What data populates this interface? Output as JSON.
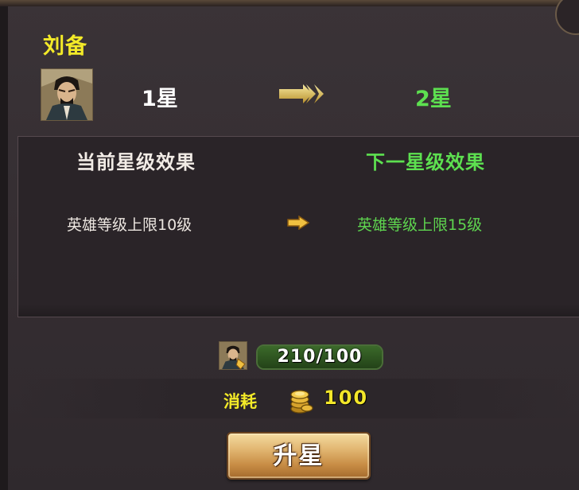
{
  "hero": {
    "name": "刘备",
    "current_star": "1星",
    "next_star": "2星"
  },
  "effects": {
    "current_title": "当前星级效果",
    "next_title": "下一星级效果",
    "current_value": "英雄等级上限10级",
    "next_value": "英雄等级上限15级"
  },
  "fragments": {
    "text": "210/100",
    "current": 210,
    "required": 100
  },
  "cost": {
    "label": "消耗",
    "value": "100",
    "currency_icon": "gold-coin-icon"
  },
  "actions": {
    "upgrade_label": "升星"
  },
  "colors": {
    "name_yellow": "#f3ea28",
    "next_green": "#5de050",
    "panel_bg": "#3a3337"
  }
}
